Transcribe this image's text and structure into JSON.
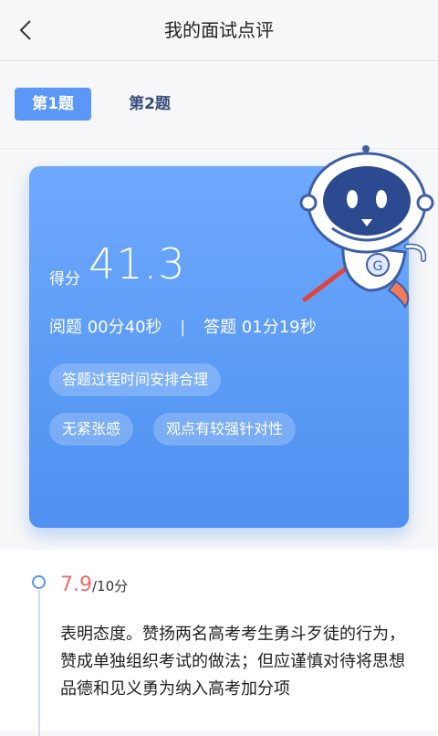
{
  "header": {
    "title": "我的面试点评"
  },
  "tabs": [
    {
      "label": "第1题"
    },
    {
      "label": "第2题"
    }
  ],
  "card": {
    "score_label": "得分",
    "score_value": "41.3",
    "read_time": "阅题 00分40秒",
    "separator": "|",
    "answer_time": "答题 01分19秒",
    "chips": [
      "答题过程时间安排合理",
      "无紧张感",
      "观点有较强针对性"
    ]
  },
  "comment": {
    "score": "7.9",
    "total": "/10分",
    "text": "表明态度。赞扬两名高考考生勇斗歹徒的行为，赞成单独组织考试的做法；但应谨慎对待将思想品德和见义勇为纳入高考加分项"
  },
  "colors": {
    "accent": "#5b97f7",
    "score_red": "#ef6a6a",
    "tab_inactive": "#3a4d78"
  }
}
